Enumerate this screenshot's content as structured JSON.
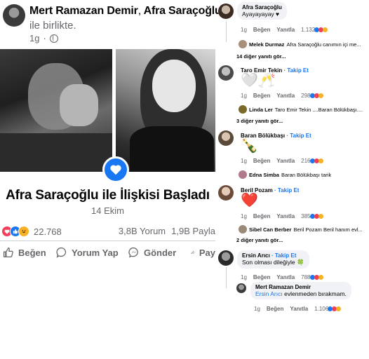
{
  "post": {
    "author_primary": "Mert Ramazan Demir",
    "separator": ",",
    "author_secondary": "Afra Saraçoğlu",
    "with_text": "ile birlikte.",
    "time": "1g",
    "event_title": "Afra Saraçoğlu ile İlişkisi Başladı",
    "event_date": "14 Ekim",
    "reaction_count": "22.768",
    "comment_count": "3,8B Yorum",
    "share_count": "1,9B Payla",
    "actions": {
      "like": "Beğen",
      "comment": "Yorum Yap",
      "send": "Gönder",
      "share": "Pay"
    }
  },
  "comments": {
    "like_label": "Beğen",
    "reply_label": "Yanıtla",
    "items": [
      {
        "name": "Afra Saraçoğlu",
        "text": "Ayayayayay ♥",
        "time": "1g",
        "count": "1.132",
        "reply_name": "Melek Durmaz",
        "reply_text": "Afra Saraçoğlu canımın içi  me...",
        "more": "14 diğer yanıtı gör..."
      },
      {
        "name": "Taro Emir Tekin",
        "follow": "· Takip Et",
        "emoji": "🤍🥂",
        "time": "1g",
        "count": "298",
        "reply_name": "Linda Ler",
        "reply_text": "Taro Emir Tekin ....Baran Bölükbaşı....",
        "more": "3 diğer yanıtı gör..."
      },
      {
        "name": "Baran Bölükbaşı",
        "follow": "· Takip Et",
        "emoji": "🍾",
        "time": "1g",
        "count": "216",
        "reply_name": "Edna Simba",
        "reply_text": "Baran Bölükbaşı tarik"
      },
      {
        "name": "Beril Pozam",
        "follow": "· Takip Et",
        "emoji": "❤️",
        "time": "1g",
        "count": "385",
        "reply_name": "Sibel Can Berber",
        "reply_text": "Beril Pozam Beril hanım evl...",
        "more": "2 diğer yanıtı gör..."
      },
      {
        "name": "Ersin Arıcı",
        "follow": "· Takip Et",
        "text": "Son olması dileğiyle 🍀",
        "time": "1g",
        "count": "788"
      }
    ],
    "nested_reply": {
      "name": "Mert Ramazan Demir",
      "mention": "Ersin Arıcı",
      "text": " evlenmeden bırakmam.",
      "time": "1g",
      "count": "1.106"
    }
  },
  "colors": {
    "facebook_blue": "#1877f2",
    "love_red": "#f33e58",
    "haha_yellow": "#f7b125",
    "muted_text": "#65676b",
    "bubble_bg": "#f0f2f5"
  }
}
